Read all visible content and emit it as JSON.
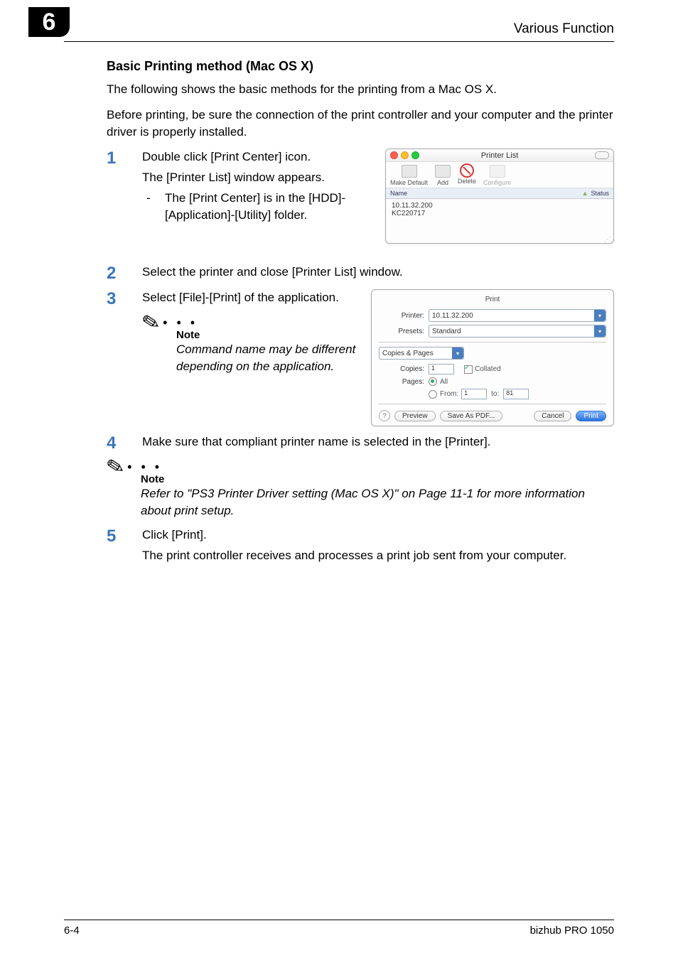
{
  "header": {
    "chapter_number": "6",
    "title": "Various Function"
  },
  "section_title": "Basic Printing method (Mac OS X)",
  "intro_para_1": "The following shows the basic methods for the printing from a Mac OS X.",
  "intro_para_2": "Before printing, be sure the connection of the print controller and your computer and the printer driver is properly installed.",
  "steps": {
    "s1": {
      "num": "1",
      "line1": "Double click [Print Center] icon.",
      "line2": "The [Printer List] window appears.",
      "bullet": "The [Print Center] is in the [HDD]-[Application]-[Utility] folder."
    },
    "s2": {
      "num": "2",
      "text": "Select the printer and close [Printer List] window."
    },
    "s3": {
      "num": "3",
      "text": "Select [File]-[Print] of the application."
    },
    "note1": {
      "label": "Note",
      "text": "Command name may be different depending on the application."
    },
    "s4": {
      "num": "4",
      "text": "Make sure that compliant printer name is selected in the [Printer]."
    },
    "note2": {
      "label": "Note",
      "text": "Refer to \"PS3 Printer Driver setting (Mac OS X)\" on Page 11-1 for more information about print setup."
    },
    "s5": {
      "num": "5",
      "line1": "Click [Print].",
      "line2": "The print controller receives and processes a print job sent from your computer."
    }
  },
  "printer_list_window": {
    "title": "Printer List",
    "toolbar": {
      "make_default": "Make Default",
      "add": "Add",
      "delete": "Delete",
      "configure": "Configure"
    },
    "columns": {
      "name": "Name",
      "status": "Status"
    },
    "rows": [
      "10.11.32.200",
      "KC220717"
    ]
  },
  "print_dialog": {
    "title": "Print",
    "printer_label": "Printer:",
    "printer_value": "10.11.32.200",
    "presets_label": "Presets:",
    "presets_value": "Standard",
    "panel_label": "Copies & Pages",
    "copies_label": "Copies:",
    "copies_value": "1",
    "collated_label": "Collated",
    "pages_label": "Pages:",
    "all_label": "All",
    "from_label": "From:",
    "from_value": "1",
    "to_label": "to:",
    "to_value": "81",
    "buttons": {
      "preview": "Preview",
      "save_pdf": "Save As PDF...",
      "cancel": "Cancel",
      "print": "Print"
    }
  },
  "footer": {
    "page": "6-4",
    "product": "bizhub PRO 1050"
  }
}
